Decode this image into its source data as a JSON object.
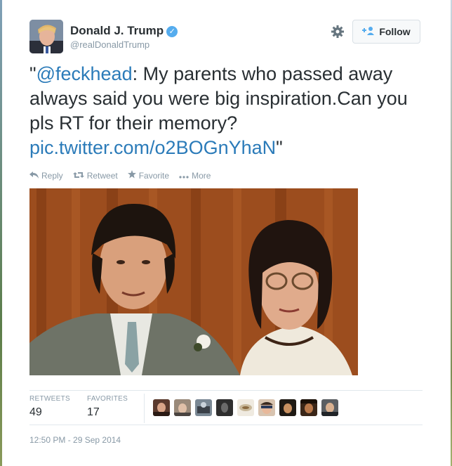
{
  "tweet": {
    "author_name": "Donald J. Trump",
    "verified_glyph": "✓",
    "handle": "@realDonaldTrump",
    "follow_label": "Follow",
    "text_quote_open": "\"",
    "mention": "@feckhead",
    "text_body": ":  My parents who passed away always said you were big inspiration.Can you pls RT for their memory? ",
    "link": "pic.twitter.com/o2BOGnYhaN",
    "text_quote_close": "\"",
    "timestamp": "12:50 PM - 29 Sep 2014"
  },
  "actions": {
    "reply_label": "Reply",
    "retweet_label": "Retweet",
    "favorite_label": "Favorite",
    "more_label": "More"
  },
  "stats": {
    "retweets_label": "RETWEETS",
    "retweets_count": "49",
    "favorites_label": "FAVORITES",
    "favorites_count": "17"
  },
  "icons": {
    "verified": "verified-badge-icon",
    "settings": "gear-icon",
    "follow": "add-user-icon",
    "reply": "reply-icon",
    "retweet": "retweet-icon",
    "favorite": "star-icon",
    "more": "more-dots-icon"
  },
  "colors": {
    "link_blue": "#2b7bb9",
    "verified_blue": "#55acee",
    "muted_gray": "#8899a6",
    "text_dark": "#292f33"
  }
}
